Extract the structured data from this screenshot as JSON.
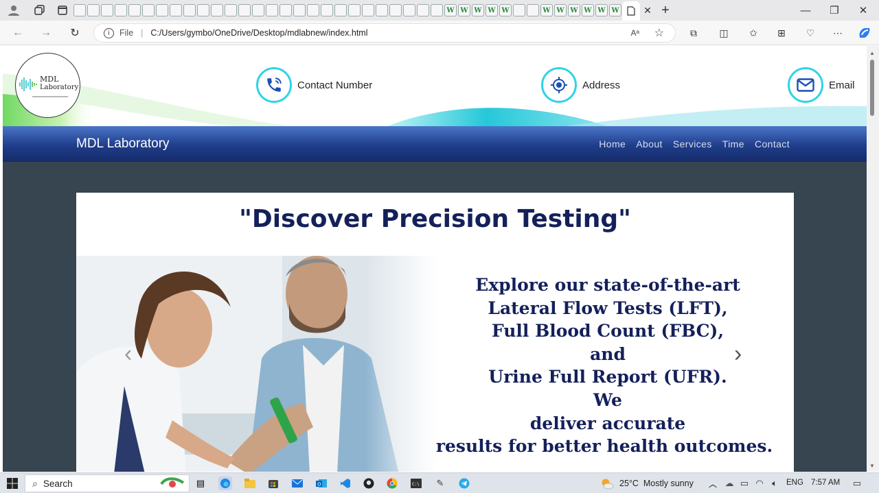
{
  "browser": {
    "tab_icons": [
      "",
      "",
      "",
      "",
      "",
      "",
      "",
      "",
      "",
      "",
      "",
      "",
      "",
      "",
      "",
      "",
      "",
      "",
      "",
      "",
      "",
      "",
      "",
      "",
      "",
      "",
      "",
      "W",
      "W",
      "W",
      "W",
      "W",
      "",
      "",
      "W",
      "W",
      "W",
      "W",
      "W",
      "W"
    ],
    "address": {
      "file_label": "File",
      "url": "C:/Users/gymbo/OneDrive/Desktop/mdlabnew/index.html"
    }
  },
  "site": {
    "logo": {
      "line1": "MDL",
      "line2": "Laboratory"
    },
    "contacts": [
      {
        "label": "Contact Number",
        "icon": "phone-icon"
      },
      {
        "label": "Address",
        "icon": "location-icon"
      },
      {
        "label": "Email",
        "icon": "mail-icon"
      }
    ],
    "brand": "MDL Laboratory",
    "nav": [
      "Home",
      "About",
      "Services",
      "Time",
      "Contact"
    ],
    "slide": {
      "headline": "\"Discover Precision Testing\"",
      "lines": [
        "Explore our state-of-the-art",
        "Lateral Flow Tests (LFT),",
        "Full Blood Count (FBC),",
        "and",
        "Urine Full Report (UFR).",
        "We",
        "deliver accurate",
        "results for better health outcomes."
      ]
    }
  },
  "taskbar": {
    "search": "Search",
    "weather": "25°C  Mostly sunny",
    "lang": "ENG",
    "time": "7:57 AM"
  }
}
